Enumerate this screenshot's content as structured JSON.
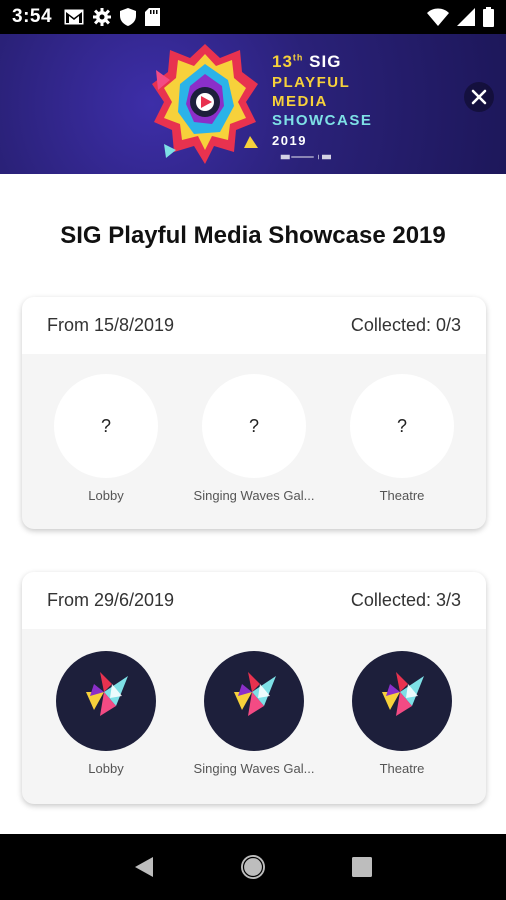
{
  "status_bar": {
    "time": "3:54",
    "left_icons": [
      "gmail-icon",
      "settings-icon",
      "shield-icon",
      "sd-card-icon"
    ],
    "right_icons": [
      "wifi-icon",
      "cell-signal-icon",
      "battery-icon"
    ]
  },
  "banner": {
    "number": "13",
    "number_suffix": "th",
    "title_word": "SIG",
    "line1": "PLAYFUL",
    "line2": "MEDIA",
    "line3": "SHOWCASE",
    "line4": "2019",
    "close_icon": "close-icon"
  },
  "page_title": "SIG Playful Media Showcase 2019",
  "cards": [
    {
      "from": "From 15/8/2019",
      "collected": "Collected: 0/3",
      "badges": [
        {
          "symbol": "?",
          "label": "Lobby",
          "collected": false
        },
        {
          "symbol": "?",
          "label": "Singing Waves Gal...",
          "collected": false
        },
        {
          "symbol": "?",
          "label": "Theatre",
          "collected": false
        }
      ]
    },
    {
      "from": "From 29/6/2019",
      "collected": "Collected: 3/3",
      "badges": [
        {
          "label": "Lobby",
          "collected": true
        },
        {
          "label": "Singing Waves Gal...",
          "collected": true
        },
        {
          "label": "Theatre",
          "collected": true
        }
      ]
    }
  ],
  "nav_bar": {
    "buttons": [
      "back-icon",
      "home-icon",
      "recents-icon"
    ]
  },
  "colors": {
    "banner_bg": "#2a2178",
    "banner_yellow": "#f7d13b",
    "banner_cyan": "#7ee0e6",
    "badge_dark": "#1d1f3b",
    "card_bg": "#f5f5f5"
  }
}
